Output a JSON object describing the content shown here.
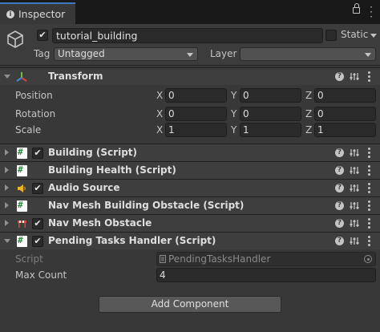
{
  "tab": {
    "title": "Inspector"
  },
  "header": {
    "object_name": "tutorial_building",
    "active": true,
    "static_label": "Static",
    "tag_label": "Tag",
    "tag_value": "Untagged",
    "layer_label": "Layer",
    "layer_value": ""
  },
  "transform": {
    "title": "Transform",
    "position": {
      "label": "Position",
      "x": "0",
      "y": "0",
      "z": "0"
    },
    "rotation": {
      "label": "Rotation",
      "x": "0",
      "y": "0",
      "z": "0"
    },
    "scale": {
      "label": "Scale",
      "x": "1",
      "y": "1",
      "z": "1"
    },
    "axes": {
      "x": "X",
      "y": "Y",
      "z": "Z"
    }
  },
  "components": [
    {
      "title": "Building (Script)",
      "enabled": true,
      "icon": "script-icon"
    },
    {
      "title": "Building Health (Script)",
      "enabled": null,
      "icon": "script-icon"
    },
    {
      "title": "Audio Source",
      "enabled": true,
      "icon": "audio-source-icon"
    },
    {
      "title": "Nav Mesh Building Obstacle (Script)",
      "enabled": null,
      "icon": "script-icon"
    },
    {
      "title": "Nav Mesh Obstacle",
      "enabled": true,
      "icon": "nav-mesh-obstacle-icon"
    },
    {
      "title": "Pending Tasks Handler (Script)",
      "enabled": true,
      "icon": "script-icon"
    }
  ],
  "pending_tasks": {
    "script_label": "Script",
    "script_value": "PendingTasksHandler",
    "max_count_label": "Max Count",
    "max_count_value": "4"
  },
  "add_component_label": "Add Component",
  "checkmark": "✔",
  "help_glyph": "?",
  "colors": {
    "accent": "#3a79bb",
    "background": "#383838",
    "header": "#3e3e3e",
    "script_green": "#2c8c3c",
    "audio_yellow": "#f0b429"
  }
}
